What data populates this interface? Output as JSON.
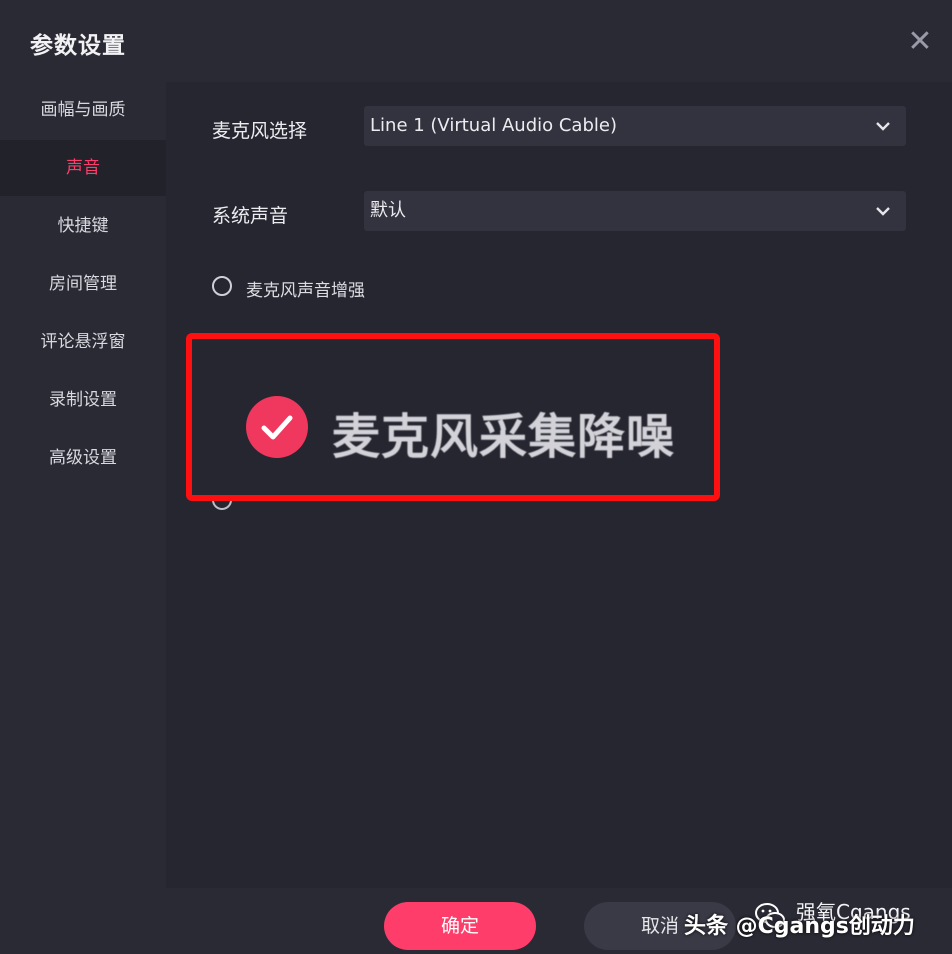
{
  "window": {
    "title": "参数设置",
    "close_icon": "close-icon"
  },
  "sidebar": {
    "items": [
      {
        "label": "画幅与画质",
        "active": false
      },
      {
        "label": "声音",
        "active": true
      },
      {
        "label": "快捷键",
        "active": false
      },
      {
        "label": "房间管理",
        "active": false
      },
      {
        "label": "评论悬浮窗",
        "active": false
      },
      {
        "label": "录制设置",
        "active": false
      },
      {
        "label": "高级设置",
        "active": false
      }
    ]
  },
  "audio": {
    "mic_label": "麦克风选择",
    "mic_value": "Line 1 (Virtual Audio Cable)",
    "system_label": "系统声音",
    "system_value": "默认",
    "enhance_label": "麦克风声音增强",
    "enhance_checked": false
  },
  "highlight": {
    "label": "麦克风采集降噪",
    "checked": true,
    "border_color": "#ff1010"
  },
  "footer": {
    "ok_label": "确定",
    "cancel_label": "取消"
  },
  "watermark": {
    "line": "头条 @Cgangs创动力",
    "account": "强氧Cgangs"
  },
  "colors": {
    "accent": "#ff3d6b",
    "background": "#262631",
    "panel": "#2a2a35"
  }
}
